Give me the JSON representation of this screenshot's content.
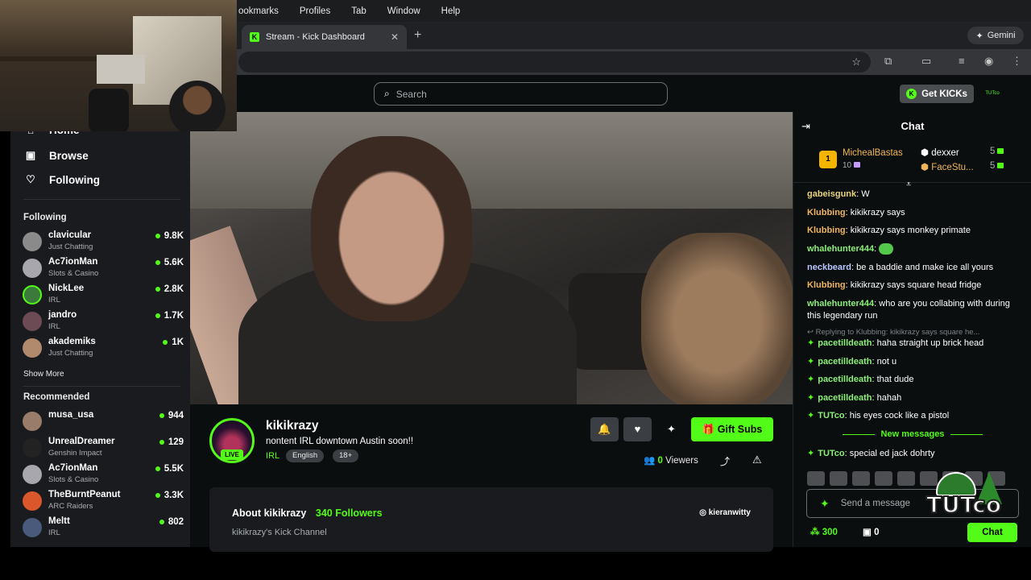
{
  "menubar": [
    "ookmarks",
    "Profiles",
    "Tab",
    "Window",
    "Help"
  ],
  "browser": {
    "tab_title": "Stream - Kick Dashboard",
    "gemini_label": "Gemini"
  },
  "header": {
    "search_placeholder": "Search",
    "get_kicks_label": "Get KICKs",
    "user_avatar_text": "TUTco"
  },
  "sidebar": {
    "nav": [
      {
        "label": "Home",
        "icon": "home-icon"
      },
      {
        "label": "Browse",
        "icon": "browse-icon"
      },
      {
        "label": "Following",
        "icon": "heart-icon"
      }
    ],
    "following_title": "Following",
    "following": [
      {
        "name": "clavicular",
        "category": "Just Chatting",
        "viewers": "9.8K"
      },
      {
        "name": "Ac7ionMan",
        "category": "Slots & Casino",
        "viewers": "5.6K"
      },
      {
        "name": "NickLee",
        "category": "IRL",
        "viewers": "2.8K"
      },
      {
        "name": "jandro",
        "category": "IRL",
        "viewers": "1.7K"
      },
      {
        "name": "akademiks",
        "category": "Just Chatting",
        "viewers": "1K"
      }
    ],
    "show_more": "Show More",
    "recommended_title": "Recommended",
    "recommended": [
      {
        "name": "musa_usa",
        "category": "",
        "viewers": "944"
      },
      {
        "name": "UnrealDreamer",
        "category": "Genshin Impact",
        "viewers": "129"
      },
      {
        "name": "Ac7ionMan",
        "category": "Slots & Casino",
        "viewers": "5.5K"
      },
      {
        "name": "TheBurntPeanut",
        "category": "ARC Raiders",
        "viewers": "3.3K"
      },
      {
        "name": "Meltt",
        "category": "IRL",
        "viewers": "802"
      }
    ]
  },
  "stream": {
    "live_label": "LIVE",
    "channel": "kikikrazy",
    "title": "nontent IRL downtown Austin soon!!",
    "category": "IRL",
    "tags": [
      "English",
      "18+"
    ],
    "gift_label": "Gift Subs",
    "viewers_count": "0",
    "viewers_label": "Viewers"
  },
  "about": {
    "heading": "About kikikrazy",
    "followers_count": "340",
    "followers_label": "Followers",
    "description": "kikikrazy's Kick Channel",
    "instagram": "kieranwitty"
  },
  "chat": {
    "title": "Chat",
    "leaderboard": {
      "first": {
        "rank": "1",
        "name": "MichealBastas",
        "count": "10"
      },
      "second": {
        "name": "dexxer",
        "count": "5"
      },
      "third": {
        "name": "FaceStu...",
        "count": "5"
      }
    },
    "messages": [
      {
        "user": "gabeisgunk",
        "color": "#e8d27a",
        "text": "W",
        "star": false
      },
      {
        "user": "Klubbing",
        "color": "#f0b55a",
        "text": "kikikrazy says",
        "star": false
      },
      {
        "user": "Klubbing",
        "color": "#f0b55a",
        "text": "kikikrazy says monkey primate",
        "star": false
      },
      {
        "user": "whalehunter444",
        "color": "#8bf078",
        "text": "",
        "star": false
      },
      {
        "user": "neckbeard",
        "color": "#b9c7ff",
        "text": "be a baddie and make ice all yours",
        "star": false
      },
      {
        "user": "Klubbing",
        "color": "#f0b55a",
        "text": "kikikrazy says square head fridge",
        "star": false
      },
      {
        "user": "whalehunter444",
        "color": "#8bf078",
        "text": "who are you collabing with during this legendary run",
        "star": false
      },
      {
        "user": "pacetilldeath",
        "color": "#8bf078",
        "text": "haha straight up brick head",
        "star": true
      },
      {
        "user": "pacetilldeath",
        "color": "#8bf078",
        "text": "not u",
        "star": true
      },
      {
        "user": "pacetilldeath",
        "color": "#8bf078",
        "text": "that dude",
        "star": true
      },
      {
        "user": "pacetilldeath",
        "color": "#8bf078",
        "text": "hahah",
        "star": true
      },
      {
        "user": "TUTco",
        "color": "#8bf078",
        "text": "his eyes cock like a pistol",
        "star": true
      },
      {
        "user": "TUTco",
        "color": "#8bf078",
        "text": "special ed jack dohrty",
        "star": true
      }
    ],
    "reply_text": "Replying to Klubbing: kikikrazy says square he...",
    "new_messages": "New messages",
    "input_placeholder": "Send a message",
    "points": "300",
    "locked_points": "0",
    "send_label": "Chat"
  },
  "overlay_text": "TUTco"
}
